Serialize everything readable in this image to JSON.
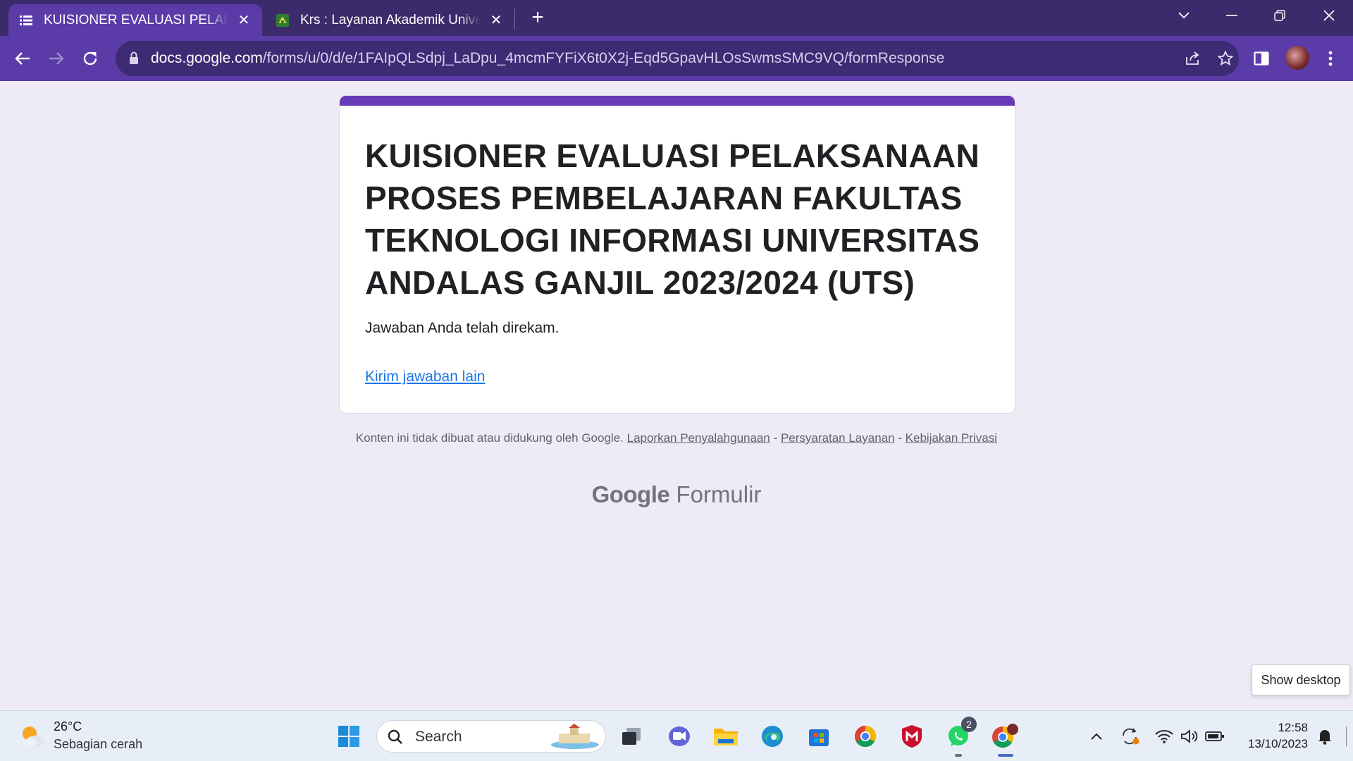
{
  "browser": {
    "tabs": [
      {
        "title": "KUISIONER EVALUASI PELAKSANAAN PROSES PEMBELAJARAN",
        "active": true,
        "favicon": "forms-list-icon"
      },
      {
        "title": "Krs : Layanan Akademik Universitas Andalas",
        "active": false,
        "favicon": "unand-logo-icon"
      }
    ],
    "url_host": "docs.google.com",
    "url_path": "/forms/u/0/d/e/1FAIpQLSdpj_LaDpu_4mcmFYFiX6t0X2j-Eqd5GpavHLOsSwmsSMC9VQ/formResponse",
    "colors": {
      "tabstrip": "#3b2b6b",
      "toolbar": "#5b3ba8",
      "omnibox": "#3d2b74"
    }
  },
  "form": {
    "title": "KUISIONER EVALUASI PELAKSANAAN PROSES PEMBELAJARAN FAKULTAS TEKNOLOGI INFORMASI UNIVERSITAS ANDALAS GANJIL 2023/2024 (UTS)",
    "message": "Jawaban Anda telah direkam.",
    "link": "Kirim jawaban lain",
    "accent": "#673ab7"
  },
  "footer": {
    "text": "Konten ini tidak dibuat atau didukung oleh Google.",
    "report": "Laporkan Penyalahgunaan",
    "sep1": " - ",
    "terms": "Persyaratan Layanan",
    "sep2": " - ",
    "privacy": "Kebijakan Privasi",
    "brand_google": "Google",
    "brand_product": "Formulir"
  },
  "tooltip": {
    "show_desktop": "Show desktop"
  },
  "taskbar": {
    "weather_temp": "26°C",
    "weather_desc": "Sebagian cerah",
    "search_placeholder": "Search",
    "whatsapp_badge": "2",
    "time": "12:58",
    "date": "13/10/2023"
  }
}
